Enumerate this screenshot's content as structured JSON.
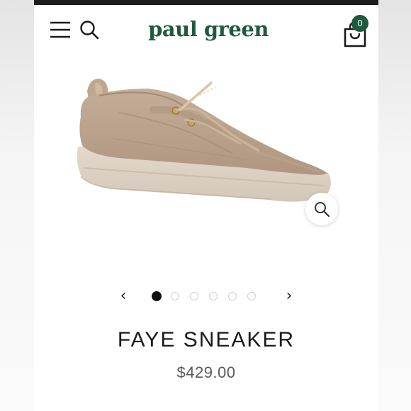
{
  "header": {
    "logo_text": "paul green",
    "cart_count": "0",
    "icons": [
      "menu-icon",
      "search-icon",
      "shopping-bag-icon"
    ]
  },
  "product": {
    "title": "FAYE SNEAKER",
    "price": "$429.00",
    "image_icon": "sneaker-image",
    "zoom_icon": "zoom-icon"
  },
  "carousel": {
    "prev_icon": "chevron-left-icon",
    "next_icon": "chevron-right-icon",
    "prev_glyph": "‹",
    "next_glyph": "›",
    "slide_count": 6,
    "active_index": 0
  },
  "colors": {
    "brand": "#1f5a3e",
    "text": "#1a1a1a",
    "price": "#5a5a5a",
    "dot_active": "#111111",
    "dot_inactive": "#cfcfcf"
  }
}
